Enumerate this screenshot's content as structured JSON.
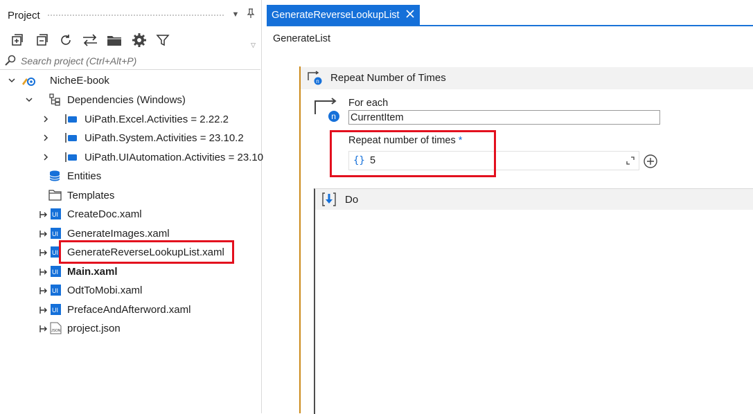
{
  "panel": {
    "title": "Project",
    "search_placeholder": "Search project (Ctrl+Alt+P)",
    "toolbar_icons": [
      "expand-all-icon",
      "collapse-all-icon",
      "refresh-icon",
      "sync-icon",
      "folder-icon",
      "settings-icon",
      "filter-icon"
    ]
  },
  "tree": {
    "root": "NicheE-book",
    "dependencies": "Dependencies (Windows)",
    "packages": [
      "UiPath.Excel.Activities = 2.22.2",
      "UiPath.System.Activities = 23.10.2",
      "UiPath.UIAutomation.Activities = 23.10"
    ],
    "entities": "Entities",
    "templates": "Templates",
    "files": [
      "CreateDoc.xaml",
      "GenerateImages.xaml",
      "GenerateReverseLookupList.xaml",
      "Main.xaml",
      "OdtToMobi.xaml",
      "PrefaceAndAfterword.xaml"
    ],
    "json_file": "project.json",
    "json_icon_text": "JSON",
    "file_icon_text": "UI"
  },
  "designer": {
    "tab_label": "GenerateReverseLookupList",
    "breadcrumb": "GenerateList",
    "activity_title": "Repeat Number of Times",
    "for_each_label": "For each",
    "item_name": "CurrentItem",
    "repeat_label": "Repeat number of times",
    "required_marker": "*",
    "expression_brace": "{}",
    "repeat_value": "5",
    "do_label": "Do"
  },
  "colors": {
    "accent": "#1570d9",
    "highlight": "#e3101e",
    "activity_border": "#cc8a1a"
  }
}
